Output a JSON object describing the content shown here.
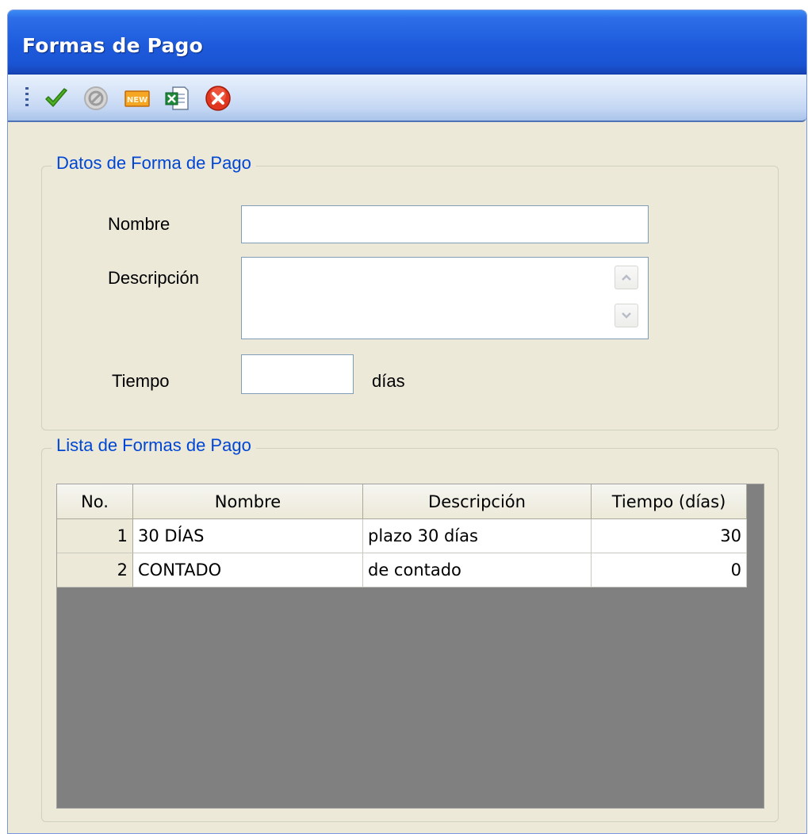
{
  "window": {
    "title": "Formas de Pago"
  },
  "toolbar": {
    "icons": [
      "check-icon",
      "disabled-cancel-icon",
      "new-icon",
      "excel-export-icon",
      "close-icon"
    ]
  },
  "form_group": {
    "legend": "Datos de Forma de Pago",
    "nombre_label": "Nombre",
    "nombre_value": "",
    "descripcion_label": "Descripción",
    "descripcion_value": "",
    "tiempo_label": "Tiempo",
    "tiempo_value": "",
    "tiempo_unit": "días"
  },
  "list_group": {
    "legend": "Lista de Formas de Pago",
    "columns": [
      "No.",
      "Nombre",
      "Descripción",
      "Tiempo (días)"
    ],
    "rows": [
      {
        "no": "1",
        "nombre": "30 DÍAS",
        "descripcion": "plazo 30 días",
        "tiempo": "30"
      },
      {
        "no": "2",
        "nombre": "CONTADO",
        "descripcion": "de contado",
        "tiempo": "0"
      }
    ]
  },
  "colors": {
    "titlebar": "#1d5bdc",
    "window_bg": "#ece9d8",
    "legend_text": "#0046d5",
    "grid_empty": "#808080"
  }
}
